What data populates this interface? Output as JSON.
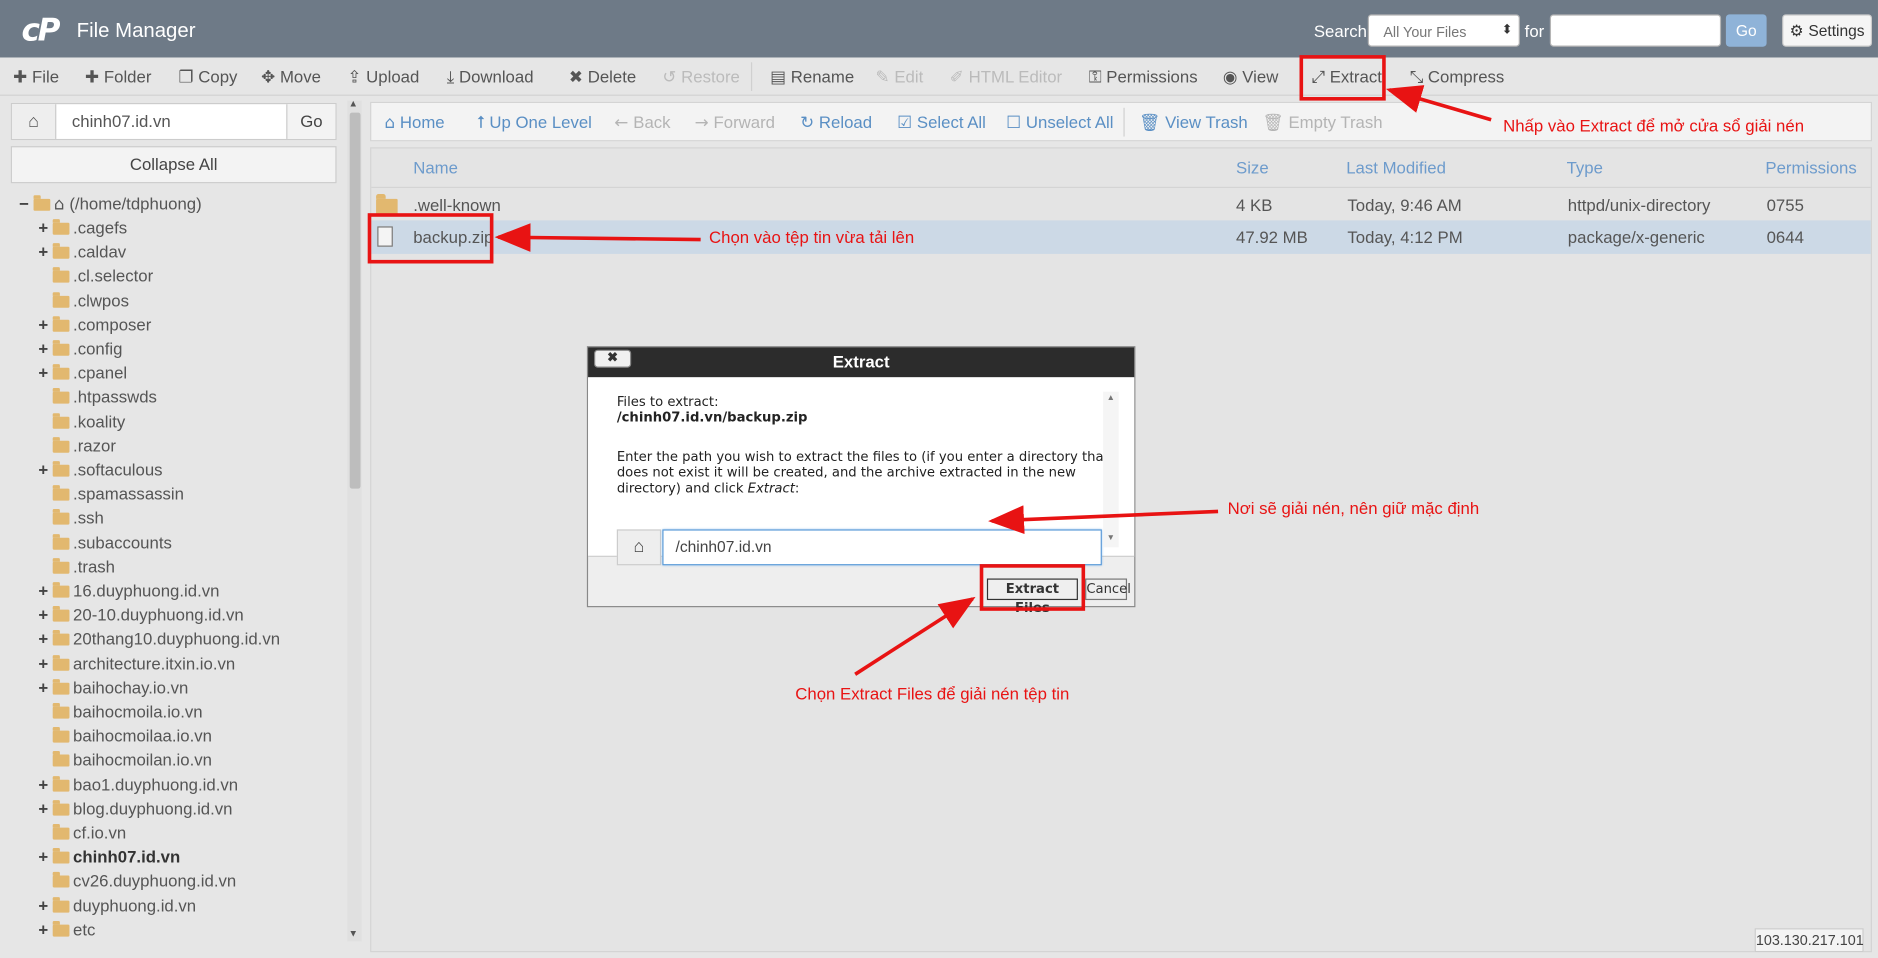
{
  "header": {
    "app_title": "File Manager",
    "search_label": "Search",
    "search_scope": "All Your Files",
    "for_label": "for",
    "search_value": "",
    "go_label": "Go",
    "settings_label": "Settings"
  },
  "toolbar": {
    "file": "File",
    "folder": "Folder",
    "copy": "Copy",
    "move": "Move",
    "upload": "Upload",
    "download": "Download",
    "delete": "Delete",
    "restore": "Restore",
    "rename": "Rename",
    "edit": "Edit",
    "html_editor": "HTML Editor",
    "permissions": "Permissions",
    "view": "View",
    "extract": "Extract",
    "compress": "Compress"
  },
  "left": {
    "path_value": "chinh07.id.vn",
    "go_label": "Go",
    "collapse_label": "Collapse All",
    "root": "(/home/tdphuong)",
    "tree": [
      {
        "name": ".cagefs",
        "expandable": true
      },
      {
        "name": ".caldav",
        "expandable": true
      },
      {
        "name": ".cl.selector",
        "expandable": false
      },
      {
        "name": ".clwpos",
        "expandable": false
      },
      {
        "name": ".composer",
        "expandable": true
      },
      {
        "name": ".config",
        "expandable": true
      },
      {
        "name": ".cpanel",
        "expandable": true
      },
      {
        "name": ".htpasswds",
        "expandable": false
      },
      {
        "name": ".koality",
        "expandable": false
      },
      {
        "name": ".razor",
        "expandable": false
      },
      {
        "name": ".softaculous",
        "expandable": true
      },
      {
        "name": ".spamassassin",
        "expandable": false
      },
      {
        "name": ".ssh",
        "expandable": false
      },
      {
        "name": ".subaccounts",
        "expandable": false
      },
      {
        "name": ".trash",
        "expandable": false
      },
      {
        "name": "16.duyphuong.id.vn",
        "expandable": true
      },
      {
        "name": "20-10.duyphuong.id.vn",
        "expandable": true
      },
      {
        "name": "20thang10.duyphuong.id.vn",
        "expandable": true
      },
      {
        "name": "architecture.itxin.io.vn",
        "expandable": true
      },
      {
        "name": "baihochay.io.vn",
        "expandable": true
      },
      {
        "name": "baihocmoila.io.vn",
        "expandable": false
      },
      {
        "name": "baihocmoilaa.io.vn",
        "expandable": false
      },
      {
        "name": "baihocmoilan.io.vn",
        "expandable": false
      },
      {
        "name": "bao1.duyphuong.id.vn",
        "expandable": true
      },
      {
        "name": "blog.duyphuong.id.vn",
        "expandable": true
      },
      {
        "name": "cf.io.vn",
        "expandable": false
      },
      {
        "name": "chinh07.id.vn",
        "expandable": true,
        "selected": true
      },
      {
        "name": "cv26.duyphuong.id.vn",
        "expandable": false
      },
      {
        "name": "duyphuong.id.vn",
        "expandable": true
      },
      {
        "name": "etc",
        "expandable": true
      }
    ]
  },
  "nav": {
    "home": "Home",
    "up": "Up One Level",
    "back": "Back",
    "forward": "Forward",
    "reload": "Reload",
    "select_all": "Select All",
    "unselect_all": "Unselect All",
    "view_trash": "View Trash",
    "empty_trash": "Empty Trash"
  },
  "table": {
    "headers": {
      "name": "Name",
      "size": "Size",
      "modified": "Last Modified",
      "type": "Type",
      "perms": "Permissions"
    },
    "rows": [
      {
        "name": ".well-known",
        "size": "4 KB",
        "modified": "Today, 9:46 AM",
        "type": "httpd/unix-directory",
        "perms": "0755"
      },
      {
        "name": "backup.zip",
        "size": "47.92 MB",
        "modified": "Today, 4:12 PM",
        "type": "package/x-generic",
        "perms": "0644"
      }
    ]
  },
  "dialog": {
    "title": "Extract",
    "close": "✖",
    "files_label": "Files to extract:",
    "file_path": "/chinh07.id.vn/backup.zip",
    "instr1": "Enter the path you wish to extract the files to (if you enter a directory that",
    "instr2": "does not exist it will be created, and the archive extracted in the new",
    "instr3": "directory) and click ",
    "instr3_em": "Extract",
    "instr3_end": ":",
    "dest_value": "/chinh07.id.vn",
    "extract_btn": "Extract Files",
    "cancel_btn": "Cancel"
  },
  "ip": "103.130.217.101",
  "annotations": {
    "extract_note": "Nhấp vào Extract để mở cửa sổ giải nén",
    "select_note": "Chọn vào tệp tin vừa tải lên",
    "path_note": "Nơi sẽ giải nén, nên giữ mặc định",
    "button_note": "Chọn Extract Files để giải nén tệp tin"
  },
  "colors": {
    "header": "#6e7a87",
    "link": "#5a8fc4",
    "annotation": "#e81313",
    "selected_row": "#ccd9e6"
  }
}
